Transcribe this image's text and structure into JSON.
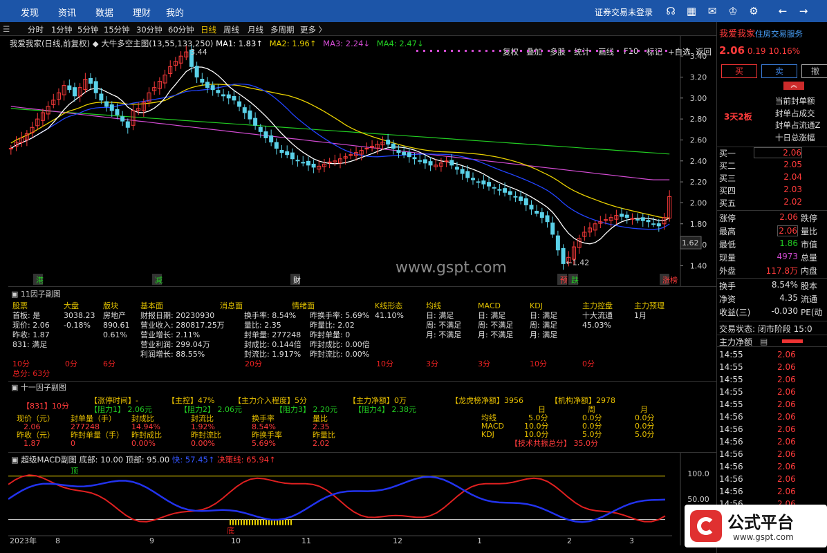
{
  "top_nav": {
    "items": [
      "发现",
      "资讯",
      "数据",
      "理财",
      "我的"
    ],
    "login": "证券交易未登录"
  },
  "period_bar": {
    "items": [
      "分时",
      "1分钟",
      "5分钟",
      "15分钟",
      "30分钟",
      "60分钟",
      "日线",
      "周线",
      "月线",
      "多周期",
      "更多 〉"
    ],
    "active": "日线"
  },
  "tools": {
    "items": [
      "复权",
      "叠加",
      "多股",
      "统计",
      "画线",
      "F10",
      "标记",
      "+自选",
      "返回"
    ]
  },
  "chart_header": {
    "title": "我爱我家(日线,前复权)",
    "indicator": "大牛多空主图(13,55,133,250)",
    "ma1": "MA1: 1.83↑",
    "ma2": "MA2: 1.96↑",
    "ma3": "MA3: 2.24↓",
    "ma4": "MA4: 2.47↓"
  },
  "chart_data": {
    "type": "candlestick",
    "y_ticks": [
      "3.40",
      "3.20",
      "3.00",
      "2.80",
      "2.60",
      "2.40",
      "2.20",
      "2.00",
      "1.80",
      "1.60",
      "1.40"
    ],
    "ylim": [
      1.35,
      3.5
    ],
    "current_price_tag": "1.62",
    "high_label": "3.44",
    "low_label": "1.42",
    "x_labels": [
      "2023年",
      "8",
      "9",
      "10",
      "11",
      "12",
      "1",
      "2",
      "3"
    ],
    "closes": [
      2.52,
      2.58,
      2.62,
      2.66,
      2.72,
      2.8,
      2.86,
      2.92,
      2.98,
      3.05,
      3.12,
      3.08,
      3.02,
      3.1,
      3.18,
      3.14,
      3.05,
      2.98,
      2.92,
      2.88,
      2.84,
      2.78,
      2.72,
      2.88,
      2.9,
      2.96,
      3.05,
      3.1,
      3.16,
      3.22,
      3.3,
      3.35,
      3.4,
      3.44,
      3.3,
      3.2,
      3.15,
      3.1,
      3.08,
      3.05,
      3.02,
      3.0,
      2.98,
      2.92,
      2.86,
      2.8,
      2.74,
      2.68,
      2.62,
      2.58,
      2.52,
      2.48,
      2.46,
      2.42,
      2.4,
      2.38,
      2.36,
      2.34,
      2.35,
      2.37,
      2.39,
      2.4,
      2.42,
      2.44,
      2.46,
      2.48,
      2.5,
      2.52,
      2.54,
      2.56,
      2.58,
      2.56,
      2.52,
      2.48,
      2.46,
      2.44,
      2.42,
      2.4,
      2.38,
      2.36,
      2.36,
      2.38,
      2.4,
      2.36,
      2.32,
      2.28,
      2.24,
      2.22,
      2.2,
      2.18,
      2.16,
      2.14,
      2.12,
      2.1,
      2.08,
      2.06,
      2.02,
      1.98,
      1.94,
      1.9,
      1.86,
      1.82,
      1.7,
      1.55,
      1.42,
      1.48,
      1.58,
      1.66,
      1.72,
      1.76,
      1.8,
      1.82,
      1.84,
      1.86,
      1.88,
      1.87,
      1.86,
      1.85,
      1.84,
      1.83,
      1.82,
      1.8,
      1.78,
      1.86,
      2.06
    ]
  },
  "markers": {
    "m1": "港",
    "m2": "减",
    "m3": "财",
    "m4": "预",
    "m5": "跌",
    "m6": "涨榜"
  },
  "watermark_site": "www.gspt.com",
  "panel11": {
    "title": "11因子副图",
    "col_gupiao": [
      "股票",
      "首板: 是",
      "现价: 2.06",
      "昨收: 1.87",
      "831: 满足"
    ],
    "col_dapan": [
      "大盘",
      "3038.23",
      "-0.18%"
    ],
    "col_bankuai": [
      "版块",
      "890.61",
      "0.61%",
      "房地产"
    ],
    "col_jiben": [
      "基本面",
      "财报日期: 20230930",
      "营业收入: 280817.25万",
      "营业增长: 2.11%",
      "营业利润: 299.04万",
      "利润增长: 88.55%"
    ],
    "col_xiaoxi": [
      "消息面",
      "换手率: 8.54%",
      "量比: 2.35",
      "封单量: 277248",
      "封成比: 0.144倍",
      "封流比: 1.917%"
    ],
    "col_qingxu": [
      "情绪面",
      "昨换手率: 5.69%",
      "昨量比: 2.02",
      "昨封单量: 0",
      "昨封成比: 0.00倍",
      "昨封流比: 0.00%"
    ],
    "col_kxian": [
      "K线形态",
      "41.10%"
    ],
    "col_junxian": [
      "均线",
      "日: 满足",
      "周: 不满足",
      "月: 不满足"
    ],
    "col_macd": [
      "MACD",
      "日: 满足",
      "周: 不满足",
      "月: 不满足"
    ],
    "col_kdj": [
      "KDJ",
      "日: 满足",
      "周: 满足",
      "月: 满足"
    ],
    "col_zhuli": [
      "主力控盘",
      "十大流通",
      "45.03%"
    ],
    "col_yuli": [
      "主力预理",
      "1月"
    ],
    "scores": [
      "10分",
      "0分",
      "6分",
      "20分",
      "10分",
      "3分",
      "3分",
      "10分",
      "0分"
    ],
    "total": "总分: 63分"
  },
  "panel_f": {
    "title": "十一因子副图",
    "row1": "【831】10分",
    "r_zhangting": "【涨停时间】-",
    "r_zhukong": "【主控】47%",
    "r_jieru": "【主力介入程度】5分",
    "r_jinge": "【主力净额】0万",
    "r_longhu": "【龙虎榜净额】3956",
    "r_jigou": "【机构净额】2978",
    "zuli1": "【阻力1】 2.06元",
    "zuli2": "【阻力2】 2.06元",
    "zuli3": "【阻力3】 2.20元",
    "zuli4": "【阻力4】 2.38元",
    "labels_a": [
      "现价（元）",
      "封单量（手）",
      "封成比",
      "封流比",
      "换手率",
      "量比"
    ],
    "values_a": [
      "2.06",
      "277248",
      "14.94%",
      "1.92%",
      "8.54%",
      "2.35"
    ],
    "labels_b": [
      "昨收（元）",
      "昨封单量（手）",
      "昨封成比",
      "昨封流比",
      "昨换手率",
      "昨量比"
    ],
    "values_b": [
      "1.87",
      "0",
      "0.00%",
      "0.00%",
      "5.69%",
      "2.02"
    ],
    "tech_head": [
      "日",
      "周",
      "月"
    ],
    "tech_rows": [
      [
        "均线",
        "5.0分",
        "0.0分",
        "0.0分"
      ],
      [
        "MACD",
        "10.0分",
        "0.0分",
        "0.0分"
      ],
      [
        "KDJ",
        "10.0分",
        "5.0分",
        "5.0分"
      ]
    ],
    "tech_total": "【技术共振总分】 35.0分"
  },
  "macd": {
    "title": "超级MACD副图",
    "bottom": "底部: 10.00",
    "top": "顶部: 95.00",
    "fast": "快: 57.45↑",
    "decision": "决策线: 65.94↑",
    "ticks": [
      "100.0",
      "50.00"
    ],
    "top_mark": "顶",
    "bottom_mark": "底"
  },
  "right": {
    "name": "我爱我家",
    "tag": "住房交易服务",
    "price": "2.06",
    "change": "0.19",
    "pct": "10.16%",
    "buy": "买",
    "sell": "卖",
    "bottom_btn": "撤",
    "board_label": "3天2板",
    "seal_labels": [
      "当前封单额",
      "封单占成交",
      "封单占流通Z",
      "十日总涨幅"
    ],
    "bids": [
      [
        "买一",
        "2.06"
      ],
      [
        "买二",
        "2.05"
      ],
      [
        "买三",
        "2.04"
      ],
      [
        "买四",
        "2.03"
      ],
      [
        "买五",
        "2.02"
      ]
    ],
    "stats": [
      [
        "涨停",
        "2.06",
        "跌停"
      ],
      [
        "最高",
        "2.06",
        "量比"
      ],
      [
        "最低",
        "1.86",
        "市值"
      ],
      [
        "现量",
        "4973",
        "总量"
      ],
      [
        "外盘",
        "117.8万",
        "内盘"
      ]
    ],
    "turnover": [
      "换手",
      "8.54%",
      "股本"
    ],
    "netasset": [
      "净资",
      "4.35",
      "流通"
    ],
    "income": [
      "收益(三)",
      "-0.030",
      "PE(动"
    ],
    "trade_status": "交易状态: 闭市阶段 15:0",
    "net_flow": "主力净额",
    "ticks": [
      [
        "14:55",
        "2.06"
      ],
      [
        "14:55",
        "2.06"
      ],
      [
        "14:55",
        "2.06"
      ],
      [
        "14:55",
        "2.06"
      ],
      [
        "14:55",
        "2.06"
      ],
      [
        "14:56",
        "2.06"
      ],
      [
        "14:56",
        "2.06"
      ],
      [
        "14:56",
        "2.06"
      ],
      [
        "14:56",
        "2.06"
      ],
      [
        "14:56",
        "2.06"
      ],
      [
        "14:56",
        "2.06"
      ],
      [
        "14:56",
        "2.06"
      ],
      [
        "14:56",
        "2.06"
      ],
      [
        "14:56",
        "2.06"
      ]
    ]
  },
  "brand": {
    "name": "公式平台",
    "url": "www.gspt.com"
  }
}
